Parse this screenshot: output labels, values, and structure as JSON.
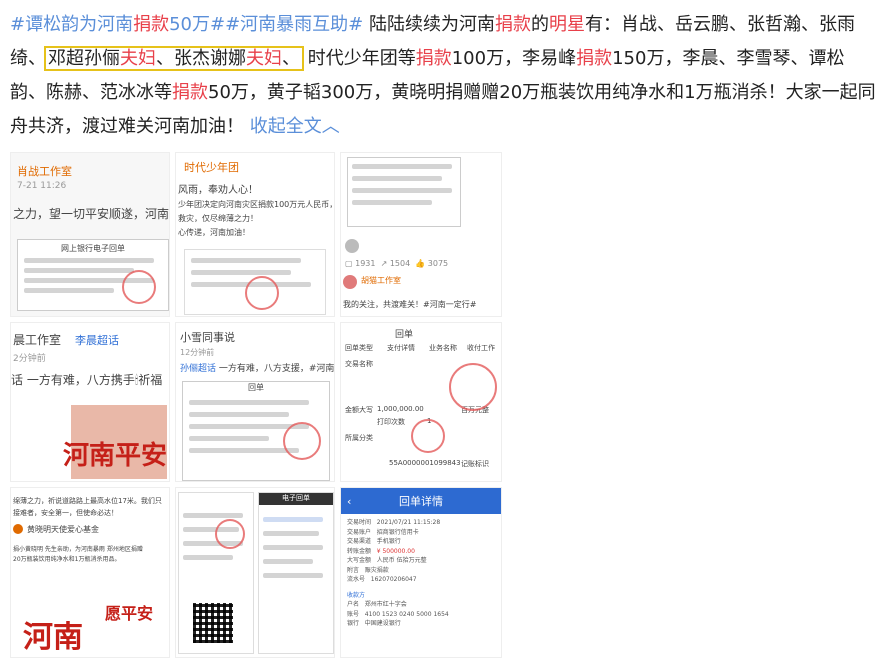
{
  "post": {
    "tag1": "#谭松韵为河南",
    "tag1_hl": "捐款",
    "tag1_end": "50万#",
    "tag2": "#河南暴雨互助#",
    "t1": " 陆陆续续为河南",
    "t1_hl": "捐款",
    "t2": "的",
    "t2_hl": "明星",
    "t3": "有：肖战、岳云鹏、张哲瀚、张雨绮、",
    "box_a": "邓超孙俪",
    "box_a_hl": "夫妇",
    "box_b": "、张杰谢娜",
    "box_b_hl": "夫妇",
    "box_c": "、",
    "t4": "时代少年团等",
    "t4_hl": "捐款",
    "t5": "100万，李易峰",
    "t5_hl": "捐款",
    "t6": "150万，李晨、李雪琴、谭松韵、陈赫、范冰冰等",
    "t6_hl": "捐款",
    "t7": "50万，黄子韬300万，黄晓明捐赠赠20万瓶装饮用纯净水和1万瓶消杀！大家一起同舟共济，渡过难关河南加油！",
    "collapse": "收起全文",
    "collapse_icon": "chevron-up-icon"
  },
  "thumbs": {
    "t1": {
      "name": "肖战工作室",
      "time": "7-21 11:26",
      "text": "之力，望一切平安顺遂，河南加油！",
      "doc": "网上银行电子回单"
    },
    "t2": {
      "name": "时代少年团",
      "text1": "风雨，奉劝人心！",
      "text2": "少年团决定向河南灾区捐款100万元人民币，",
      "text3": "救灾，仅尽绵薄之力！",
      "text4": "心传递，河南加油！"
    },
    "t3": {
      "comments": "1931",
      "shares": "1504",
      "likes": "3075",
      "name": "胡猫工作室",
      "text": "我的关注，共渡难关！#河南一定行#"
    },
    "t4": {
      "name": "晨工作室",
      "sub": "李晨超话",
      "time": "2分钟前",
      "text": "话 一方有难，八方携手",
      "text_b": "祈福",
      "banner": "河南平安"
    },
    "t5": {
      "name": "小雪同事说",
      "time": "12分钟前",
      "tag": "孙俪超话",
      "text": "一方有难，八方支援，#河南一定行#",
      "doc": "回单"
    },
    "t6": {
      "title": "回单",
      "label1": "回单类型",
      "label2": "交易名称",
      "label3": "支付详情",
      "label4": "业务名称",
      "label5": "收付工作",
      "amt": "1,000,000.00",
      "label6": "金额大写",
      "label7": "打印次数",
      "label8": "1",
      "label9": "所属分类",
      "label10": "百万元整",
      "num": "55A0000001099843",
      "label11": "记账标识"
    },
    "t7": {
      "text1": "绵薄之力，祈说道路路上最高水位17米。我们只",
      "text2": "接难者，安全第一，但使命必达！",
      "name": "黄晓明天使爱心基金",
      "text3": "捐小黄晓明 先生亲助，为河南暴雨 郑州地区捐赠",
      "text4": "20万瓶装饮用纯净水和1万瓶消杀用品。",
      "banner": "河南",
      "banner2": "愿平安"
    },
    "t8": {
      "doc": "电子回单"
    },
    "t9": {
      "title": "回单详情",
      "r1k": "交易时间",
      "r1v": "2021/07/21 11:15:28",
      "r2k": "交易账户",
      "r2v": "招商银行信用卡",
      "r3k": "交易渠道",
      "r3v": "手机银行",
      "r4k": "转账金额",
      "r4v": "¥ 500000.00",
      "r5k": "大写金额",
      "r5v": "人民币 伍拾万元整",
      "r6k": "附言",
      "r6v": "赈灾捐款",
      "r7k": "流水号",
      "r7v": "162070206047",
      "sec": "收款方",
      "r8k": "户名",
      "r8v": "郑州市红十字会",
      "r9k": "账号",
      "r9v": "4100 1523 0240 5000 1654",
      "r10k": "银行",
      "r10v": "中国建设银行"
    }
  }
}
